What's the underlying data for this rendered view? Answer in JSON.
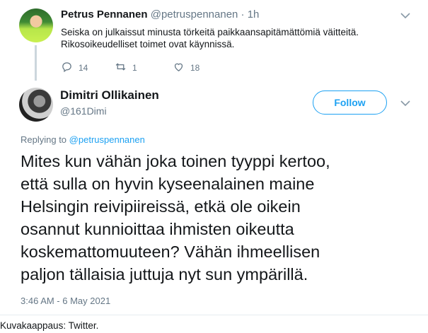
{
  "parent_tweet": {
    "display_name": "Petrus Pennanen",
    "handle": "@petruspennanen",
    "separator": "·",
    "age": "1h",
    "text_lines": [
      "Seiska on julkaissut minusta törkeitä paikkaansapitämättömiä väitteitä.",
      "Rikosoikeudelliset toimet ovat käynnissä."
    ],
    "reply_count": "14",
    "retweet_count": "1",
    "like_count": "18"
  },
  "main_tweet": {
    "display_name": "Dimitri Ollikainen",
    "handle": "@161Dimi",
    "follow_label": "Follow",
    "replying_prefix": "Replying to",
    "replying_handle": "@petruspennanen",
    "body_lines": [
      "Mites kun vähän joka toinen tyyppi kertoo,",
      "että sulla on hyvin kyseenalainen maine",
      "Helsingin reivipiireissä, etkä ole oikein",
      "osannut kunnioittaa ihmisten oikeutta",
      "koskemattomuuteen? Vähän ihmeellisen",
      "paljon tällaisia juttuja nyt sun ympärillä."
    ],
    "timestamp": "3:46 AM - 6 May 2021"
  },
  "caption": "Kuvakaappaus: Twitter.",
  "icons": {
    "reply": "reply-icon",
    "retweet": "retweet-icon",
    "like": "heart-icon",
    "more": "chevron-down-icon"
  },
  "colors": {
    "accent": "#1da1f2",
    "muted": "#657786",
    "text": "#14171a",
    "thread_line": "#ccd6dd"
  }
}
